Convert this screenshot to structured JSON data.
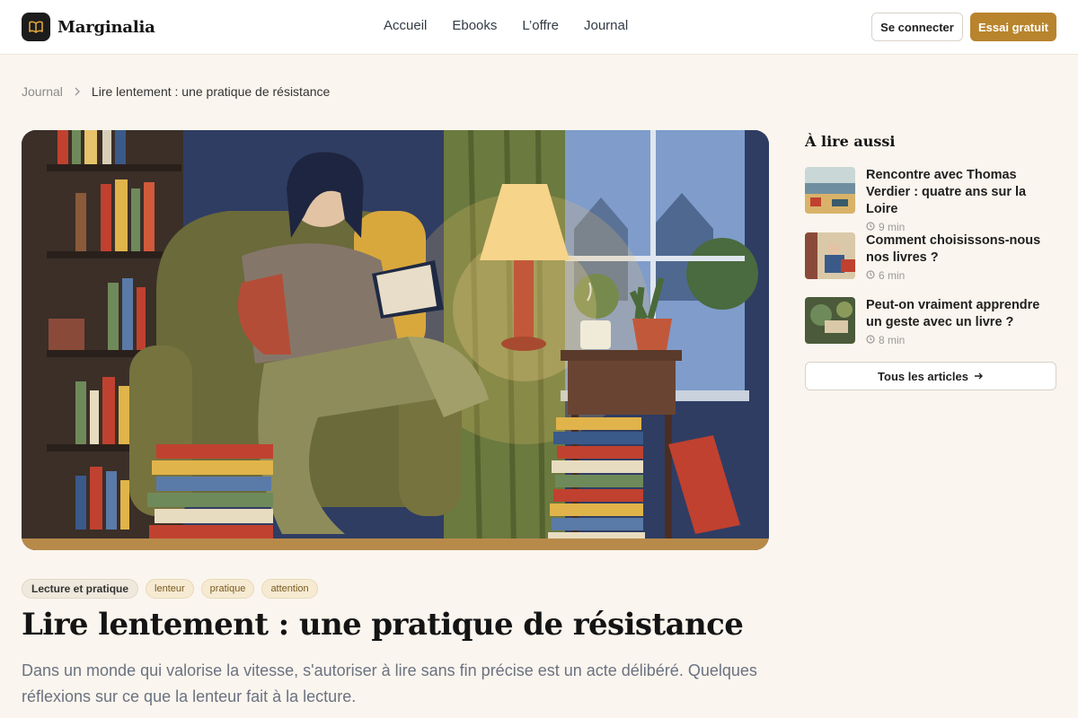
{
  "brand": {
    "name": "Marginalia",
    "logo_icon": "open-book-icon"
  },
  "nav": {
    "items": [
      "Accueil",
      "Ebooks",
      "L’offre",
      "Journal"
    ]
  },
  "header": {
    "login_label": "Se connecter",
    "trial_label": "Essai gratuit"
  },
  "breadcrumb": {
    "parent": "Journal",
    "current": "Lire lentement : une pratique de résistance"
  },
  "article": {
    "category": "Lecture et pratique",
    "tags": [
      "lenteur",
      "pratique",
      "attention"
    ],
    "title": "Lire lentement : une pratique de résistance",
    "lead": "Dans un monde qui valorise la vitesse, s'autoriser à lire sans fin précise est un acte délibéré. Quelques réflexions sur ce que la lenteur fait à la lecture."
  },
  "sidebar": {
    "title": "À lire aussi",
    "items": [
      {
        "title": "Rencontre avec Thomas Verdier : quatre ans sur la Loire",
        "time": "9 min"
      },
      {
        "title": "Comment choisissons-nous nos livres ?",
        "time": "6 min"
      },
      {
        "title": "Peut-on vraiment apprendre un geste avec un livre ?",
        "time": "8 min"
      }
    ],
    "all_label": "Tous les articles"
  },
  "colors": {
    "accent": "#b8842d",
    "background": "#faf5ee"
  }
}
